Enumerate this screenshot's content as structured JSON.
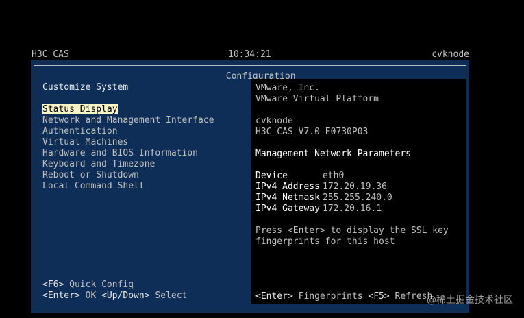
{
  "topbar": {
    "product": "H3C CAS",
    "time": "10:34:21",
    "hostname": "cvknode"
  },
  "dialog": {
    "title": "Configuration"
  },
  "left_pane": {
    "heading": "Customize System",
    "menu": [
      "Status Display",
      "Network and Management Interface",
      "Authentication",
      "Virtual Machines",
      "Hardware and BIOS Information",
      "Keyboard and Timezone",
      "Reboot or Shutdown",
      "Local Command Shell"
    ],
    "selected_index": 0,
    "footer": {
      "f6_key": "<F6>",
      "f6_label": " Quick Config",
      "enter_key": "<Enter>",
      "enter_label": " OK ",
      "updown_key": "<Up/Down>",
      "updown_label": " Select"
    }
  },
  "right_pane": {
    "vendor": "VMware, Inc.",
    "product": "VMware Virtual Platform",
    "hostname": "cvknode",
    "version": "H3C CAS V7.0 E0730P03",
    "mgmt_heading": "Management Network Parameters",
    "params": {
      "device_label": "Device",
      "device_value": "eth0",
      "address_label": "IPv4 Address",
      "address_value": "172.20.19.36",
      "netmask_label": "IPv4 Netmask",
      "netmask_value": "255.255.240.0",
      "gateway_label": "IPv4 Gateway",
      "gateway_value": "172.20.16.1"
    },
    "press_line1": "Press <Enter> to display the SSL key",
    "press_line2": "fingerprints for this host",
    "footer": {
      "enter_key": "<Enter>",
      "enter_label": " Fingerprints ",
      "f5_key": "<F5>",
      "f5_label": " Refresh"
    }
  },
  "watermark": "@稀土掘金技术社区",
  "colors": {
    "background": "#000000",
    "dialog_bg": "#0e2e57",
    "highlight_bg": "#f7f4c8",
    "text": "#c0c0c0"
  }
}
